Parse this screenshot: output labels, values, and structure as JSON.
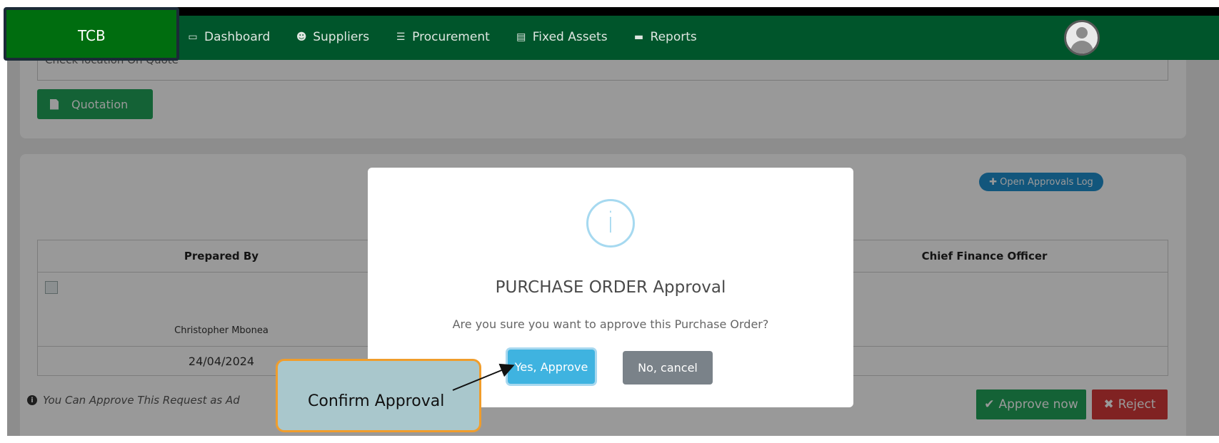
{
  "brand": {
    "name": "TCB"
  },
  "nav": {
    "items": [
      {
        "label": "Dashboard",
        "icon": "monitor-icon"
      },
      {
        "label": "Suppliers",
        "icon": "users-icon"
      },
      {
        "label": "Procurement",
        "icon": "list-icon"
      },
      {
        "label": "Fixed Assets",
        "icon": "asset-icon"
      },
      {
        "label": "Reports",
        "icon": "report-icon"
      }
    ],
    "avatar_icon": "user-avatar-icon"
  },
  "delivery": {
    "location_value": "Check location On Quote",
    "quotation_label": "Quotation"
  },
  "approvals": {
    "open_log_label": "Open Approvals Log",
    "columns": [
      "Prepared By",
      "Chief Finance Officer"
    ],
    "prepared_by_name": "Christopher Mbonea",
    "prepared_by_date": "24/04/2024",
    "note": "You Can Approve This Request as Ad",
    "approve_label": "Approve now",
    "reject_label": "Reject"
  },
  "modal": {
    "icon": "info-icon",
    "title": "PURCHASE ORDER Approval",
    "text": "Are you sure you want to approve this Purchase Order?",
    "confirm_label": "Yes, Approve",
    "cancel_label": "No, cancel"
  },
  "callout": {
    "text": "Confirm Approval"
  },
  "colors": {
    "navbar": "#00552b",
    "brand_box": "#006d0f",
    "confirm": "#3fb3e0",
    "cancel": "#7a8289",
    "approve": "#22a45a",
    "reject": "#d63a3a",
    "callout_border": "#f09d2c"
  }
}
